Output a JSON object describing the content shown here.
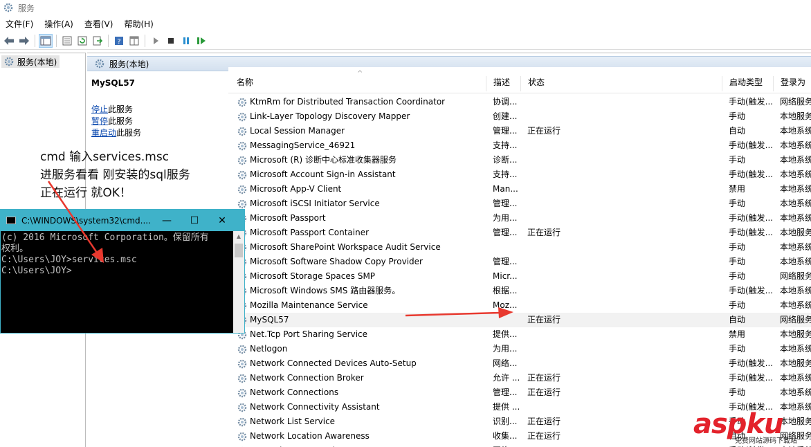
{
  "window": {
    "title": "服务"
  },
  "menu": [
    "文件(F)",
    "操作(A)",
    "查看(V)",
    "帮助(H)"
  ],
  "tree": {
    "root_label": "服务(本地)"
  },
  "header": {
    "label": "服务(本地)"
  },
  "detail": {
    "service_name": "MySQL57",
    "actions": [
      {
        "link": "停止",
        "rest": "此服务"
      },
      {
        "link": "暂停",
        "rest": "此服务"
      },
      {
        "link": "重启动",
        "rest": "此服务"
      }
    ]
  },
  "columns": {
    "name": "名称",
    "desc": "描述",
    "status": "状态",
    "startup": "启动类型",
    "logon": "登录为"
  },
  "services": [
    {
      "name": "KtmRm for Distributed Transaction Coordinator",
      "desc": "协调...",
      "status": "",
      "startup": "手动(触发...",
      "logon": "网络服务"
    },
    {
      "name": "Link-Layer Topology Discovery Mapper",
      "desc": "创建...",
      "status": "",
      "startup": "手动",
      "logon": "本地服务"
    },
    {
      "name": "Local Session Manager",
      "desc": "管理...",
      "status": "正在运行",
      "startup": "自动",
      "logon": "本地系统"
    },
    {
      "name": "MessagingService_46921",
      "desc": "支持...",
      "status": "",
      "startup": "手动(触发...",
      "logon": "本地系统"
    },
    {
      "name": "Microsoft (R) 诊断中心标准收集器服务",
      "desc": "诊断...",
      "status": "",
      "startup": "手动",
      "logon": "本地系统"
    },
    {
      "name": "Microsoft Account Sign-in Assistant",
      "desc": "支持...",
      "status": "",
      "startup": "手动(触发...",
      "logon": "本地系统"
    },
    {
      "name": "Microsoft App-V Client",
      "desc": "Man...",
      "status": "",
      "startup": "禁用",
      "logon": "本地系统"
    },
    {
      "name": "Microsoft iSCSI Initiator Service",
      "desc": "管理...",
      "status": "",
      "startup": "手动",
      "logon": "本地系统"
    },
    {
      "name": "Microsoft Passport",
      "desc": "为用...",
      "status": "",
      "startup": "手动(触发...",
      "logon": "本地系统"
    },
    {
      "name": "Microsoft Passport Container",
      "desc": "管理...",
      "status": "正在运行",
      "startup": "手动(触发...",
      "logon": "本地服务"
    },
    {
      "name": "Microsoft SharePoint Workspace Audit Service",
      "desc": "",
      "status": "",
      "startup": "手动",
      "logon": "本地系统"
    },
    {
      "name": "Microsoft Software Shadow Copy Provider",
      "desc": "管理...",
      "status": "",
      "startup": "手动",
      "logon": "本地系统"
    },
    {
      "name": "Microsoft Storage Spaces SMP",
      "desc": "Micr...",
      "status": "",
      "startup": "手动",
      "logon": "网络服务"
    },
    {
      "name": "Microsoft Windows SMS 路由器服务。",
      "desc": "根据...",
      "status": "",
      "startup": "手动(触发...",
      "logon": "本地系统"
    },
    {
      "name": "Mozilla Maintenance Service",
      "desc": "Moz...",
      "status": "",
      "startup": "手动",
      "logon": "本地系统"
    },
    {
      "name": "MySQL57",
      "desc": "",
      "status": "正在运行",
      "startup": "自动",
      "logon": "网络服务"
    },
    {
      "name": "Net.Tcp Port Sharing Service",
      "desc": "提供...",
      "status": "",
      "startup": "禁用",
      "logon": "本地服务"
    },
    {
      "name": "Netlogon",
      "desc": "为用...",
      "status": "",
      "startup": "手动",
      "logon": "本地系统"
    },
    {
      "name": "Network Connected Devices Auto-Setup",
      "desc": "网络...",
      "status": "",
      "startup": "手动(触发...",
      "logon": "本地服务"
    },
    {
      "name": "Network Connection Broker",
      "desc": "允许 ...",
      "status": "正在运行",
      "startup": "手动(触发...",
      "logon": "本地系统"
    },
    {
      "name": "Network Connections",
      "desc": "管理...",
      "status": "正在运行",
      "startup": "手动",
      "logon": "本地系统"
    },
    {
      "name": "Network Connectivity Assistant",
      "desc": "提供 ...",
      "status": "",
      "startup": "手动(触发...",
      "logon": "本地系统"
    },
    {
      "name": "Network List Service",
      "desc": "识别...",
      "status": "正在运行",
      "startup": "手动",
      "logon": "本地服务"
    },
    {
      "name": "Network Location Awareness",
      "desc": "收集...",
      "status": "正在运行",
      "startup": "自动",
      "logon": "网络服务"
    },
    {
      "name": "Network Setup Service",
      "desc": "网络...",
      "status": "",
      "startup": "手动(触发...",
      "logon": "本地系统"
    }
  ],
  "annotation": {
    "line1": "cmd 输入services.msc",
    "line2": "进服务看看 刚安装的sql服务",
    "line3": " 正在运行 就OK！"
  },
  "cmd": {
    "title": "C:\\WINDOWS\\system32\\cmd....",
    "lines": [
      "(c) 2016 Microsoft Corporation。保留所有",
      "权利。",
      "",
      "C:\\Users\\JOY>services.msc",
      "",
      "C:\\Users\\JOY>"
    ]
  },
  "watermark": {
    "big": "aspku",
    "small": "免费网站源码下载站"
  },
  "colors": {
    "accent_cyan": "#3fb2c9",
    "arrow_red": "#e8392f",
    "header_blue": "#d4e1ef"
  }
}
